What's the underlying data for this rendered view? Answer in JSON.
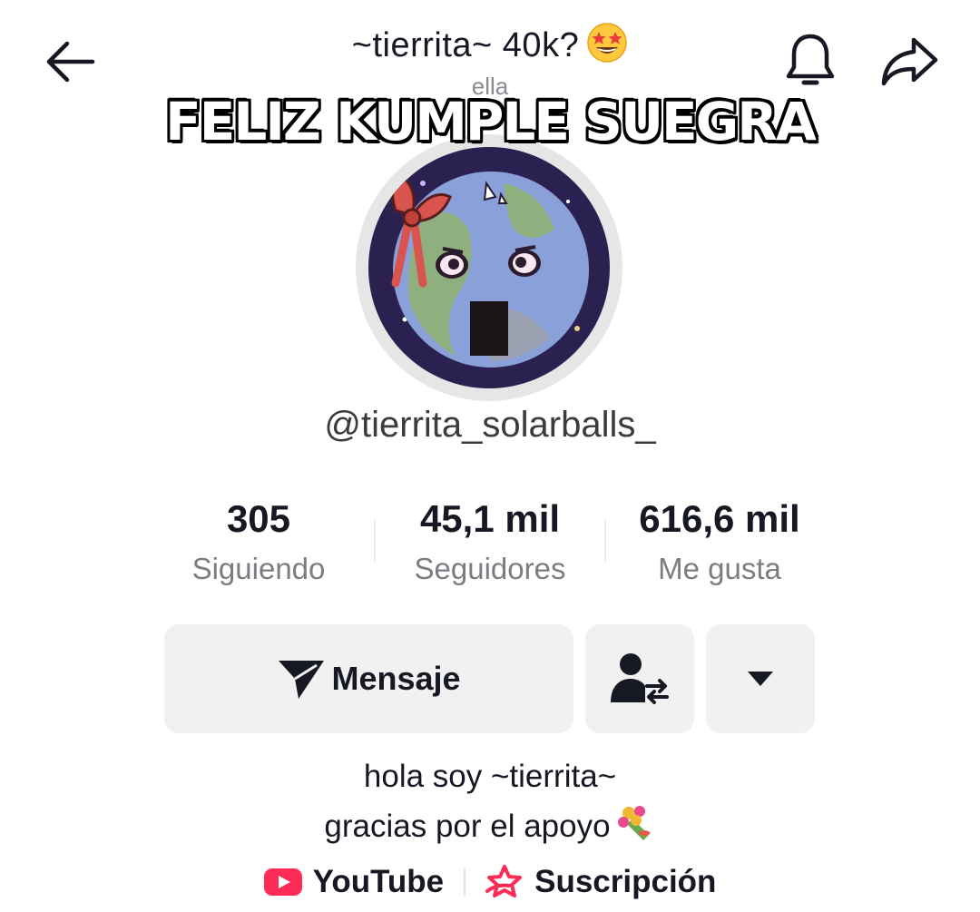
{
  "header": {
    "title": "~tierrita~ 40k?",
    "title_emoji": "star-struck-emoji",
    "pronoun": "ella",
    "back_icon": "back-arrow-icon",
    "bell_icon": "bell-icon",
    "share_icon": "share-icon"
  },
  "overlay_text": "FELIZ KUMPLE SUEGRA",
  "profile": {
    "username": "@tierrita_solarballs_",
    "avatar": "avatar-planet-with-red-bow"
  },
  "stats": [
    {
      "value": "305",
      "label": "Siguiendo"
    },
    {
      "value": "45,1 mil",
      "label": "Seguidores"
    },
    {
      "value": "616,6 mil",
      "label": "Me gusta"
    }
  ],
  "actions": {
    "message_label": "Mensaje",
    "message_icon": "send-icon",
    "friends_icon": "person-swap-icon",
    "more_icon": "caret-down-icon"
  },
  "bio": {
    "line1": "hola soy ~tierrita~",
    "line2": "gracias por el apoyo",
    "line2_emoji": "bouquet-emoji"
  },
  "links": {
    "youtube_label": "YouTube",
    "subscription_label": "Suscripción",
    "youtube_color": "#FE2C55",
    "subscription_color": "#FE2C55"
  }
}
